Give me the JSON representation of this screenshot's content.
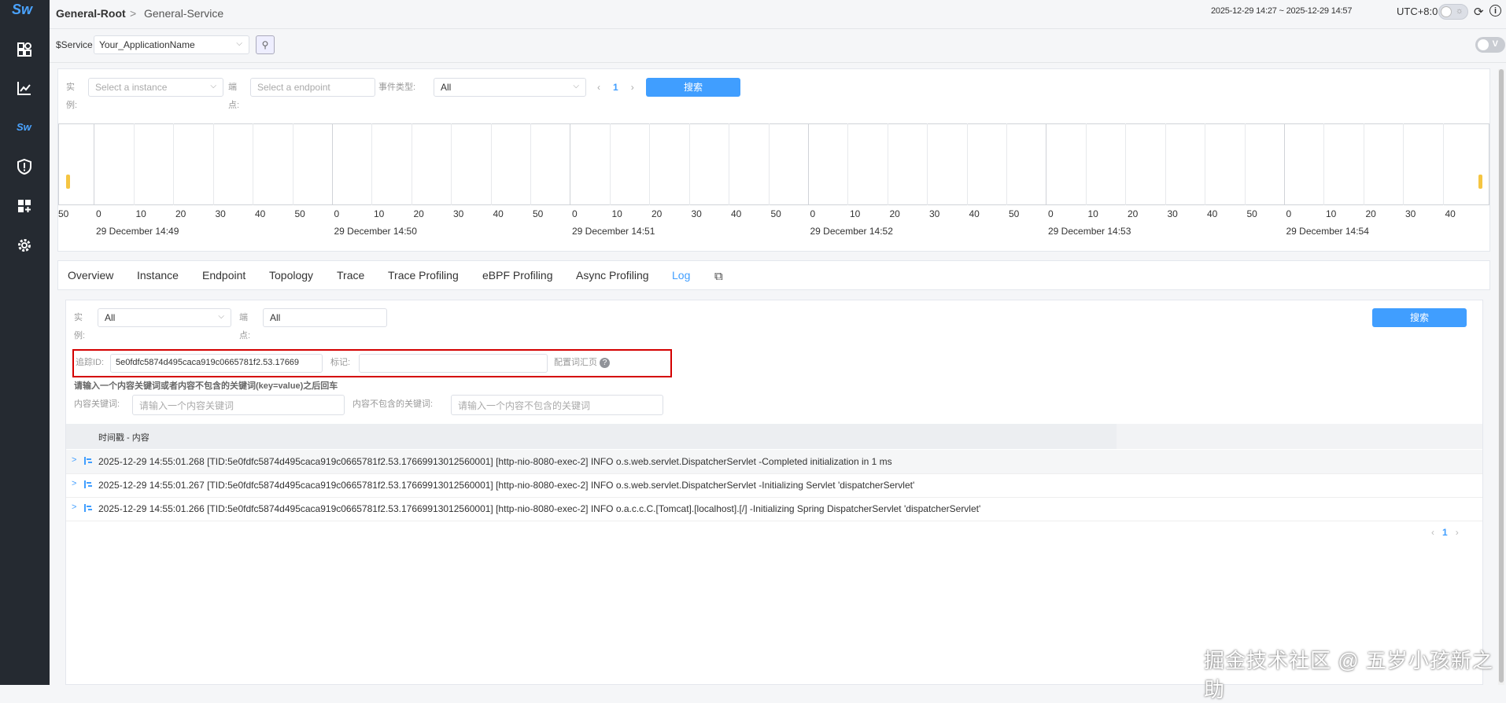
{
  "brand": {
    "logo": "Sw"
  },
  "sidebar": {
    "items": [
      {
        "icon": "marketplace-icon"
      },
      {
        "icon": "dashboard-chart-icon"
      },
      {
        "icon": "skywalking-icon"
      },
      {
        "icon": "alarm-icon"
      },
      {
        "icon": "add-widget-icon"
      },
      {
        "icon": "settings-gear-icon"
      }
    ]
  },
  "header": {
    "breadcrumb_root": "General-Root",
    "breadcrumb_sep": ">",
    "breadcrumb_service": "General-Service",
    "time_range": "2025-12-29 14:27 ~ 2025-12-29 14:57",
    "timezone": "UTC+8:0"
  },
  "service_bar": {
    "label": "$Service",
    "selected": "Your_ApplicationName",
    "toggle_label": "V"
  },
  "profiling_filter": {
    "instance_label_1": "实",
    "instance_label_2": "例:",
    "instance_placeholder": "Select a instance",
    "endpoint_label_1": "端",
    "endpoint_label_2": "点:",
    "endpoint_placeholder": "Select a endpoint",
    "event_type_label": "事件类型:",
    "event_type_value": "All",
    "page": "1",
    "search_label": "搜索"
  },
  "timeline": {
    "segments": [
      {
        "date": "29 December 14:49"
      },
      {
        "date": "29 December 14:50"
      },
      {
        "date": "29 December 14:51"
      },
      {
        "date": "29 December 14:52"
      },
      {
        "date": "29 December 14:53"
      },
      {
        "date": "29 December 14:54"
      }
    ],
    "first_tick": "50",
    "ticks": [
      "0",
      "10",
      "20",
      "30",
      "40",
      "50"
    ],
    "last_ticks": [
      "0",
      "10",
      "20",
      "30",
      "40"
    ]
  },
  "tabs": [
    {
      "label": "Overview",
      "active": false
    },
    {
      "label": "Instance",
      "active": false
    },
    {
      "label": "Endpoint",
      "active": false
    },
    {
      "label": "Topology",
      "active": false
    },
    {
      "label": "Trace",
      "active": false
    },
    {
      "label": "Trace Profiling",
      "active": false
    },
    {
      "label": "eBPF Profiling",
      "active": false
    },
    {
      "label": "Async Profiling",
      "active": false
    },
    {
      "label": "Log",
      "active": true
    }
  ],
  "log_filter": {
    "instance_label_1": "实",
    "instance_label_2": "例:",
    "instance_value": "All",
    "endpoint_label_1": "端",
    "endpoint_label_2": "点:",
    "endpoint_value": "All",
    "search_label": "搜索",
    "trace_id_label": "追踪ID:",
    "trace_id_value": "5e0fdfc5874d495caca919c0665781f2.53.17669",
    "tag_label": "标记:",
    "tag_value": "",
    "config_link": "配置词汇页",
    "keyword_hint": "请输入一个内容关键词或者内容不包含的关键词(key=value)之后回车",
    "keyword_label": "内容关键词:",
    "keyword_placeholder": "请输入一个内容关键词",
    "exclude_label": "内容不包含的关键词:",
    "exclude_placeholder": "请输入一个内容不包含的关键词"
  },
  "log_table": {
    "header": "时间戳 - 内容",
    "rows": [
      {
        "text": "2025-12-29 14:55:01.268 [TID:5e0fdfc5874d495caca919c0665781f2.53.17669913012560001] [http-nio-8080-exec-2] INFO o.s.web.servlet.DispatcherServlet -Completed initialization in 1 ms"
      },
      {
        "text": "2025-12-29 14:55:01.267 [TID:5e0fdfc5874d495caca919c0665781f2.53.17669913012560001] [http-nio-8080-exec-2] INFO o.s.web.servlet.DispatcherServlet -Initializing Servlet 'dispatcherServlet'"
      },
      {
        "text": "2025-12-29 14:55:01.266 [TID:5e0fdfc5874d495caca919c0665781f2.53.17669913012560001] [http-nio-8080-exec-2] INFO o.a.c.c.C.[Tomcat].[localhost].[/] -Initializing Spring DispatcherServlet 'dispatcherServlet'"
      }
    ],
    "page": "1"
  },
  "watermark": "掘金技术社区 @ 五岁小孩新之助",
  "colors": {
    "accent": "#409eff",
    "sidebar": "#252a31",
    "highlight_box": "#d40000",
    "timeline_handle": "#f5c542"
  }
}
